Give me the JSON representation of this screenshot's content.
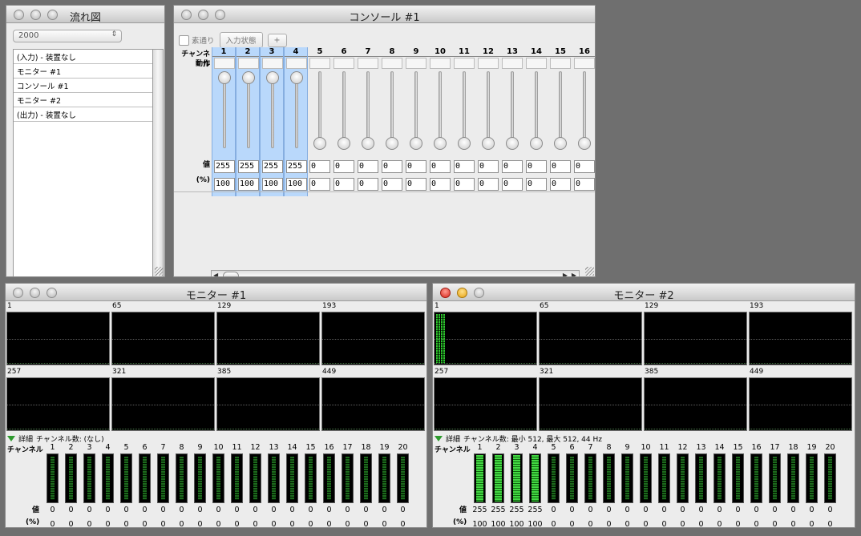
{
  "flow": {
    "title": "流れ図",
    "popup_value": "2000",
    "items": [
      "(入力) - 装置なし",
      "モニター #1",
      "コンソール #1",
      "モニター #2",
      "(出力) - 装置なし"
    ]
  },
  "console": {
    "title": "コンソール #1",
    "passthrough_label": "素通り",
    "input_state_label": "入力状態",
    "add_label": "+",
    "channel_label": "チャンネル",
    "action_label": "動作",
    "value_label": "値",
    "percent_label": "(%)",
    "channels": [
      {
        "n": "1",
        "value": "255",
        "percent": "100",
        "selected": true
      },
      {
        "n": "2",
        "value": "255",
        "percent": "100",
        "selected": true
      },
      {
        "n": "3",
        "value": "255",
        "percent": "100",
        "selected": true
      },
      {
        "n": "4",
        "value": "255",
        "percent": "100",
        "selected": true
      },
      {
        "n": "5",
        "value": "0",
        "percent": "0",
        "selected": false
      },
      {
        "n": "6",
        "value": "0",
        "percent": "0",
        "selected": false
      },
      {
        "n": "7",
        "value": "0",
        "percent": "0",
        "selected": false
      },
      {
        "n": "8",
        "value": "0",
        "percent": "0",
        "selected": false
      },
      {
        "n": "9",
        "value": "0",
        "percent": "0",
        "selected": false
      },
      {
        "n": "10",
        "value": "0",
        "percent": "0",
        "selected": false
      },
      {
        "n": "11",
        "value": "0",
        "percent": "0",
        "selected": false
      },
      {
        "n": "12",
        "value": "0",
        "percent": "0",
        "selected": false
      },
      {
        "n": "13",
        "value": "0",
        "percent": "0",
        "selected": false
      },
      {
        "n": "14",
        "value": "0",
        "percent": "0",
        "selected": false
      },
      {
        "n": "15",
        "value": "0",
        "percent": "0",
        "selected": false
      },
      {
        "n": "16",
        "value": "0",
        "percent": "0",
        "selected": false
      }
    ]
  },
  "monitor1": {
    "title": "モニター #1",
    "section_labels": [
      "1",
      "65",
      "129",
      "193",
      "257",
      "321",
      "385",
      "449"
    ],
    "details_label": "詳細",
    "channel_count": "チャンネル数: (なし)",
    "channel_label": "チャンネル",
    "value_label": "値",
    "percent_label": "(%)",
    "channels": [
      "1",
      "2",
      "3",
      "4",
      "5",
      "6",
      "7",
      "8",
      "9",
      "10",
      "11",
      "12",
      "13",
      "14",
      "15",
      "16",
      "17",
      "18",
      "19",
      "20"
    ],
    "values": [
      "0",
      "0",
      "0",
      "0",
      "0",
      "0",
      "0",
      "0",
      "0",
      "0",
      "0",
      "0",
      "0",
      "0",
      "0",
      "0",
      "0",
      "0",
      "0",
      "0"
    ],
    "percents": [
      "0",
      "0",
      "0",
      "0",
      "0",
      "0",
      "0",
      "0",
      "0",
      "0",
      "0",
      "0",
      "0",
      "0",
      "0",
      "0",
      "0",
      "0",
      "0",
      "0"
    ],
    "levels": [
      0,
      0,
      0,
      0,
      0,
      0,
      0,
      0,
      0,
      0,
      0,
      0,
      0,
      0,
      0,
      0,
      0,
      0,
      0,
      0
    ]
  },
  "monitor2": {
    "title": "モニター #2",
    "section_labels": [
      "1",
      "65",
      "129",
      "193",
      "257",
      "321",
      "385",
      "449"
    ],
    "details_label": "詳細",
    "channel_count": "チャンネル数: 最小 512, 最大 512, 44 Hz",
    "channel_label": "チャンネル",
    "value_label": "値",
    "percent_label": "(%)",
    "channels": [
      "1",
      "2",
      "3",
      "4",
      "5",
      "6",
      "7",
      "8",
      "9",
      "10",
      "11",
      "12",
      "13",
      "14",
      "15",
      "16",
      "17",
      "18",
      "19",
      "20"
    ],
    "values": [
      "255",
      "255",
      "255",
      "255",
      "0",
      "0",
      "0",
      "0",
      "0",
      "0",
      "0",
      "0",
      "0",
      "0",
      "0",
      "0",
      "0",
      "0",
      "0",
      "0"
    ],
    "percents": [
      "100",
      "100",
      "100",
      "100",
      "0",
      "0",
      "0",
      "0",
      "0",
      "0",
      "0",
      "0",
      "0",
      "0",
      "0",
      "0",
      "0",
      "0",
      "0",
      "0"
    ],
    "levels": [
      1,
      1,
      1,
      1,
      0,
      0,
      0,
      0,
      0,
      0,
      0,
      0,
      0,
      0,
      0,
      0,
      0,
      0,
      0,
      0
    ]
  },
  "colors": {
    "accent_selection": "#b9d8fb",
    "meter_green": "#43d843",
    "close_red": "#d7261b",
    "minimize_yellow": "#e7a312"
  }
}
